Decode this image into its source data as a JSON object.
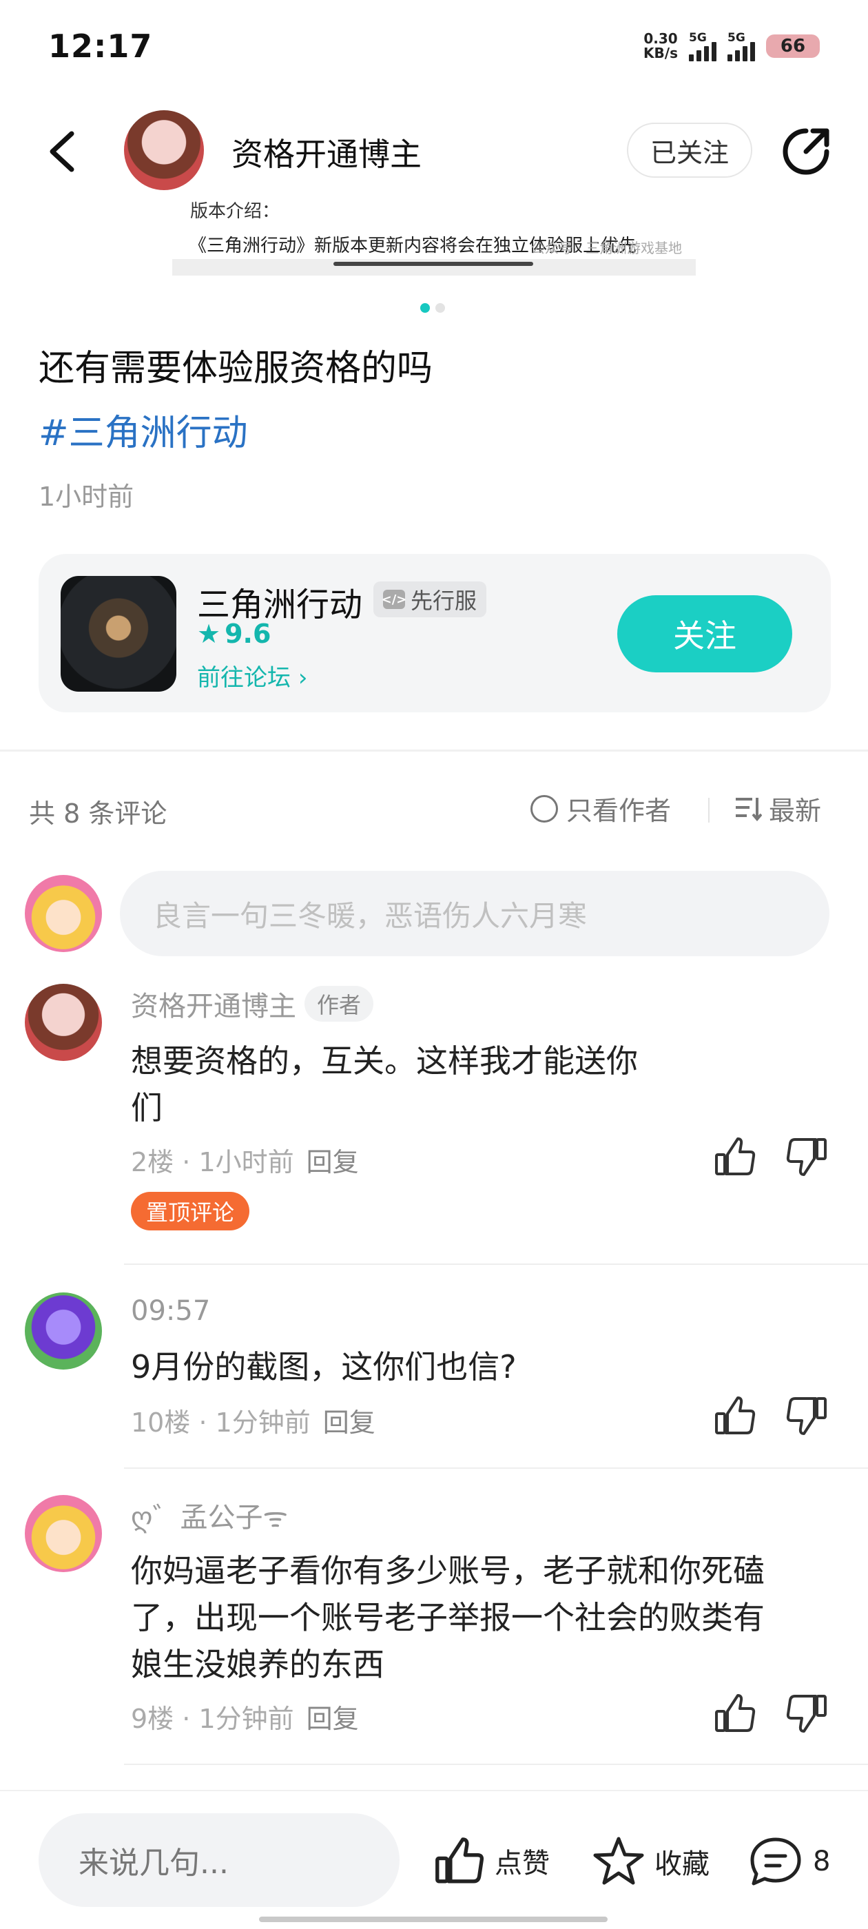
{
  "status_bar": {
    "time": "12:17",
    "net_speed_value": "0.30",
    "net_speed_unit": "KB/s",
    "sim1_label": "5G",
    "sim2_label": "5G",
    "battery": "66"
  },
  "header": {
    "username": "资格开通博主",
    "follow_label": "已关注"
  },
  "image_strip": {
    "line1": "版本介绍：",
    "line2": "《三角洲行动》新版本更新内容将会在独立体验服上优先",
    "watermark": "公众号 · 三角洲游戏基地"
  },
  "post": {
    "title": "还有需要体验服资格的吗",
    "tag": "#三角洲行动",
    "time": "1小时前"
  },
  "game_card": {
    "name": "三角洲行动",
    "badge": "先行服",
    "rating": "9.6",
    "forum_link": "前往论坛",
    "follow_label": "关注"
  },
  "comments_header": {
    "count": "共 8 条评论",
    "author_only": "只看作者",
    "sort": "最新"
  },
  "comment_input": {
    "placeholder": "良言一句三冬暖，恶语伤人六月寒"
  },
  "comments": [
    {
      "user": "资格开通博主",
      "author_tag": "作者",
      "line1": "想要资格的，互关。这样我才能送你",
      "line2": "们",
      "floor": "2楼",
      "time": "1小时前",
      "reply": "回复",
      "pin": "置顶评论"
    },
    {
      "user": "09:57",
      "line1": "9月份的截图，这你们也信?",
      "floor": "10楼",
      "time": "1分钟前",
      "reply": "回复"
    },
    {
      "user": "ღ゛孟公子ᯤ",
      "line1": "你妈逼老子看你有多少账号，老子就和你死磕",
      "line2": "了，出现一个账号老子举报一个社会的败类有",
      "line3": "娘生没娘养的东西",
      "floor": "9楼",
      "time": "1分钟前",
      "reply": "回复"
    }
  ],
  "bottom_bar": {
    "input_placeholder": "来说几句...",
    "like": "点赞",
    "favorite": "收藏",
    "comment_count": "8"
  },
  "colors": {
    "accent": "#1bcfc4",
    "tag_blue": "#2a72c4",
    "pin_orange": "#f56b32"
  }
}
